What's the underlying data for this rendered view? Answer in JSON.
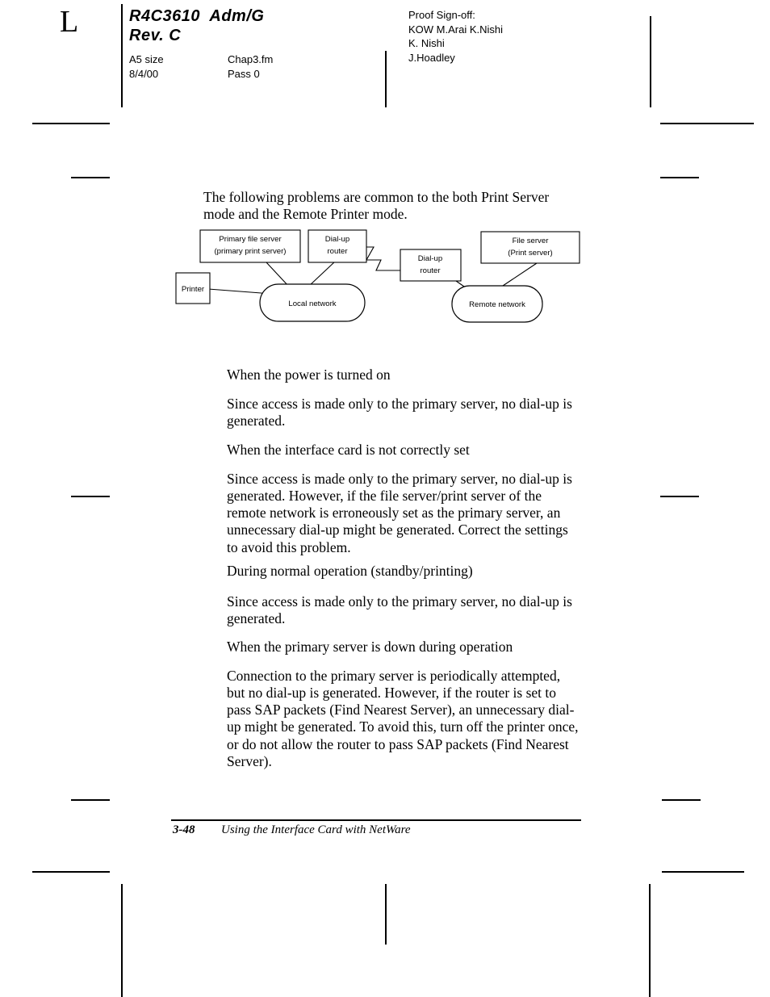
{
  "page": {
    "fold_mark_letter": "L"
  },
  "header": {
    "doc_id_line1": "R4C3610  Adm/G",
    "doc_id_line2": "Rev. C",
    "meta": [
      {
        "left": "A5 size",
        "right": "Chap3.fm"
      },
      {
        "left": "8/4/00",
        "right": "Pass 0"
      }
    ],
    "signoff": [
      "Proof Sign-off:",
      "KOW M.Arai  K.Nishi",
      "K. Nishi",
      "J.Hoadley"
    ]
  },
  "body": {
    "intro": "The following problems are common to the both Print Server mode and the Remote Printer mode.",
    "sections": [
      {
        "heading": "When the power is turned on",
        "text": "Since access is made only to the primary server, no dial-up is generated."
      },
      {
        "heading": "When the interface card is not correctly set",
        "text": "Since access is made only to the primary server, no dial-up is generated. However, if the file server/print server of the remote network is erroneously set as the primary server, an unnecessary dial-up might be generated. Correct the settings to avoid this problem."
      },
      {
        "heading": "During normal operation (standby/printing)",
        "text": "Since access is made only to the primary server, no dial-up is generated."
      },
      {
        "heading": "When the primary server is down during operation",
        "text": "Connection to the primary server is periodically attempted, but no dial-up is generated. However, if the router is set to pass SAP packets (Find Nearest Server), an unnecessary dial-up might be generated. To avoid this, turn off the printer once, or do not allow the router to pass SAP packets (Find Nearest Server)."
      }
    ]
  },
  "diagram": {
    "type": "network-topology",
    "nodes": [
      {
        "id": "primary-file-server",
        "shape": "rect",
        "line1": "Primary file server",
        "line2": "(primary print server)"
      },
      {
        "id": "dialup-router-local",
        "shape": "rect",
        "line1": "Dial-up",
        "line2": "router"
      },
      {
        "id": "dialup-router-remote",
        "shape": "rect",
        "line1": "Dial-up",
        "line2": "router"
      },
      {
        "id": "file-server-remote",
        "shape": "rect",
        "line1": "File server",
        "line2": "(Print server)"
      },
      {
        "id": "printer",
        "shape": "rect",
        "line1": "Printer",
        "line2": ""
      },
      {
        "id": "local-network",
        "shape": "stadium",
        "line1": "Local network",
        "line2": ""
      },
      {
        "id": "remote-network",
        "shape": "stadium",
        "line1": "Remote network",
        "line2": ""
      }
    ],
    "edges": [
      {
        "from": "primary-file-server",
        "to": "local-network"
      },
      {
        "from": "dialup-router-local",
        "to": "local-network"
      },
      {
        "from": "printer",
        "to": "local-network"
      },
      {
        "from": "dialup-router-local",
        "to": "dialup-router-remote",
        "style": "zigzag"
      },
      {
        "from": "dialup-router-remote",
        "to": "remote-network"
      },
      {
        "from": "file-server-remote",
        "to": "remote-network"
      }
    ]
  },
  "footer": {
    "page_number": "3-48",
    "running_title": "Using the Interface Card with NetWare"
  },
  "colors": {
    "ink": "#000000",
    "paper": "#ffffff"
  }
}
